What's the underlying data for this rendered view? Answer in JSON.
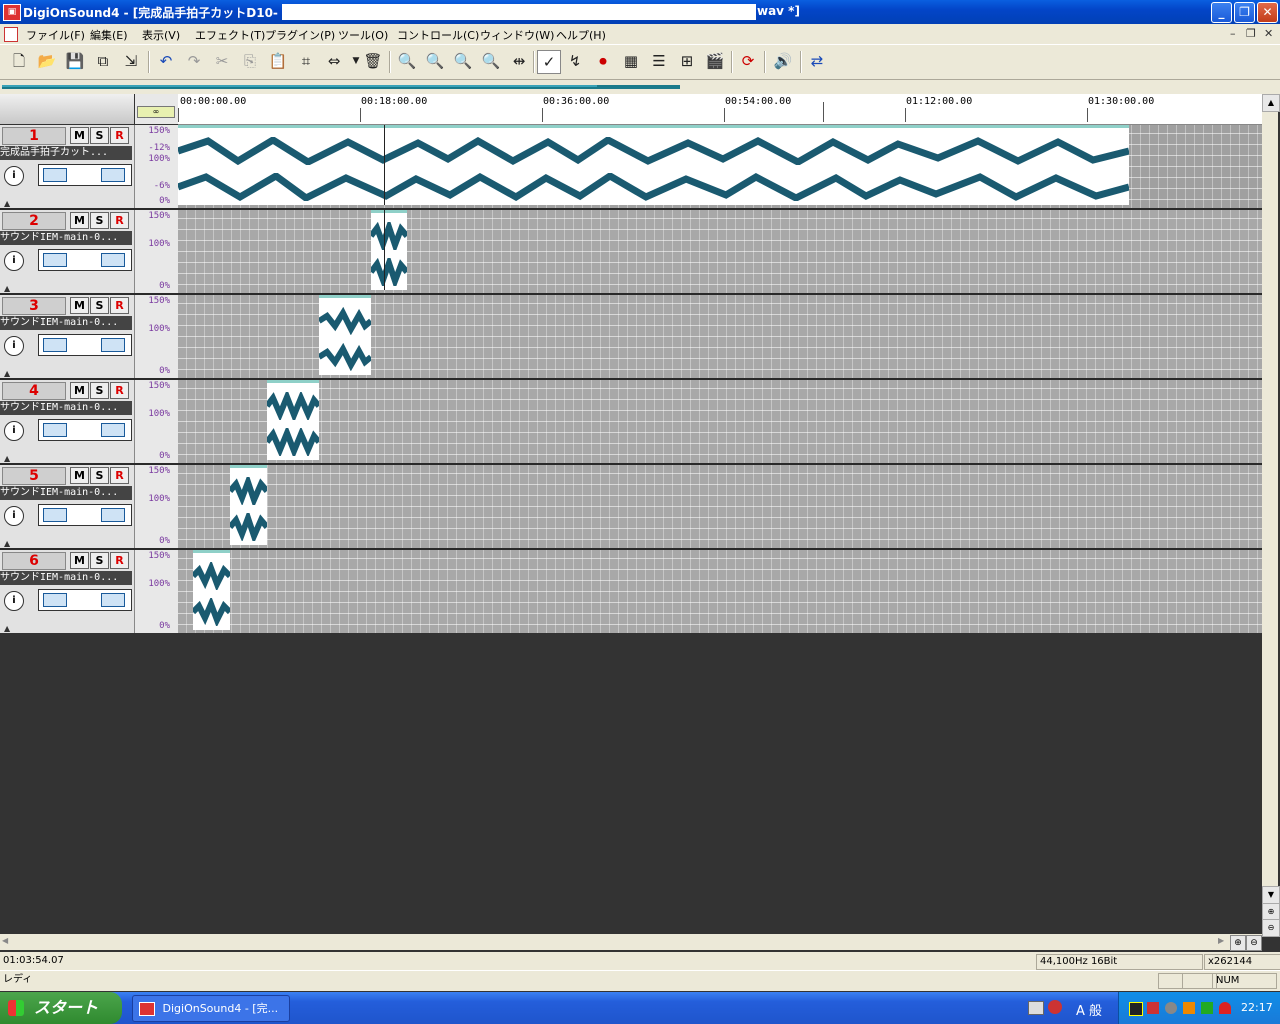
{
  "window": {
    "title_prefix": "DigiOnSound4 - [完成品手拍子カットD10-",
    "title_suffix": "wav *]",
    "min": "_",
    "restore": "❐",
    "close": "✕"
  },
  "menu": {
    "items": [
      "ファイル(F)",
      "編集(E)",
      "表示(V)",
      "エフェクト(T)",
      "プラグイン(P)",
      "ツール(O)",
      "コントロール(C)",
      "ウィンドウ(W)",
      "ヘルプ(H)"
    ],
    "mdi_min": "–",
    "mdi_restore": "❐",
    "mdi_close": "✕"
  },
  "toolbar": {
    "icons": [
      "new-file-icon",
      "open-folder-icon",
      "save-icon",
      "save-all-icon",
      "export-icon",
      "undo-icon",
      "redo-icon",
      "cut-icon",
      "copy-icon",
      "paste-icon",
      "crop-icon",
      "expand-icon",
      "delete-icon",
      "zoom-in-icon",
      "zoom-fit-icon",
      "zoom-out-icon",
      "zoom-selection-icon",
      "zoom-range-icon",
      "envelope-icon",
      "fade-icon",
      "record-icon",
      "mixer-icon",
      "track-list-icon",
      "effects-icon",
      "clapper-icon",
      "loop-icon",
      "speaker-icon",
      "marker-icon"
    ]
  },
  "ruler": {
    "labels": [
      "00:00:00.00",
      "00:18:00.00",
      "00:36:00.00",
      "00:54:00.00",
      "01:12:00.00",
      "01:30:00.00"
    ]
  },
  "link_button": "∞",
  "tracks": [
    {
      "number": "1",
      "mute": "M",
      "solo": "S",
      "rec": "R",
      "name": "完成品手拍子カット...",
      "scale": [
        "150%",
        "-12%",
        "100%",
        "-6%",
        "0%"
      ]
    },
    {
      "number": "2",
      "mute": "M",
      "solo": "S",
      "rec": "R",
      "name": "サウンドIEM-main-0...",
      "scale": [
        "150%",
        "100%",
        "0%"
      ]
    },
    {
      "number": "3",
      "mute": "M",
      "solo": "S",
      "rec": "R",
      "name": "サウンドIEM-main-0...",
      "scale": [
        "150%",
        "100%",
        "0%"
      ]
    },
    {
      "number": "4",
      "mute": "M",
      "solo": "S",
      "rec": "R",
      "name": "サウンドIEM-main-0...",
      "scale": [
        "150%",
        "100%",
        "0%"
      ]
    },
    {
      "number": "5",
      "mute": "M",
      "solo": "S",
      "rec": "R",
      "name": "サウンドIEM-main-0...",
      "scale": [
        "150%",
        "100%",
        "0%"
      ]
    },
    {
      "number": "6",
      "mute": "M",
      "solo": "S",
      "rec": "R",
      "name": "サウンドIEM-main-0...",
      "scale": [
        "150%",
        "100%",
        "0%"
      ]
    }
  ],
  "status": {
    "position": "01:03:54.07",
    "format": "44,100Hz 16Bit",
    "samples": "x262144",
    "ready": "レディ",
    "num": "NUM"
  },
  "taskbar": {
    "start": "スタート",
    "task_label": "DigiOnSound4 - [完...",
    "ime": "A 般",
    "clock": "22:17"
  },
  "colors": {
    "waveform": "#1a5a70",
    "track_number": "#dd0000",
    "scale_text": "#7a3aa0",
    "clip_header": "#8fd0c8"
  }
}
